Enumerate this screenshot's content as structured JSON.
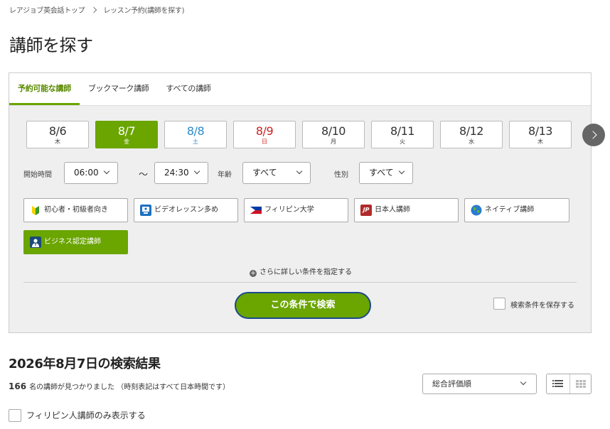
{
  "breadcrumb": {
    "home": "レアジョブ英会話トップ",
    "current": "レッスン予約(講師を探す)"
  },
  "page_title": "講師を探す",
  "tabs": [
    {
      "label": "予約可能な講師",
      "active": true
    },
    {
      "label": "ブックマーク講師",
      "active": false
    },
    {
      "label": "すべての講師",
      "active": false
    }
  ],
  "dates": [
    {
      "date": "8/6",
      "weekday": "木",
      "type": "normal"
    },
    {
      "date": "8/7",
      "weekday": "金",
      "type": "selected"
    },
    {
      "date": "8/8",
      "weekday": "土",
      "type": "sat"
    },
    {
      "date": "8/9",
      "weekday": "日",
      "type": "sun"
    },
    {
      "date": "8/10",
      "weekday": "月",
      "type": "normal"
    },
    {
      "date": "8/11",
      "weekday": "火",
      "type": "normal"
    },
    {
      "date": "8/12",
      "weekday": "水",
      "type": "normal"
    },
    {
      "date": "8/13",
      "weekday": "木",
      "type": "normal"
    }
  ],
  "filters": {
    "start_time_label": "開始時間",
    "start_from": "06:00",
    "tilde": "〜",
    "start_to": "24:30",
    "age_label": "年齢",
    "age_value": "すべて",
    "gender_label": "性別",
    "gender_value": "すべて"
  },
  "tags": [
    {
      "label": "初心者・初級者向き",
      "icon": "beginner-mark-icon",
      "active": false
    },
    {
      "label": "ビデオレッスン多め",
      "icon": "video-lesson-icon",
      "active": false
    },
    {
      "label": "フィリピン大学",
      "icon": "university-icon",
      "active": false
    },
    {
      "label": "日本人講師",
      "icon": "jp-icon",
      "active": false
    },
    {
      "label": "ネイティブ講師",
      "icon": "globe-icon",
      "active": false
    },
    {
      "label": "ビジネス認定講師",
      "icon": "business-person-icon",
      "active": true
    }
  ],
  "jp_icon_text": "JP",
  "more_conditions": "さらに詳しい条件を指定する",
  "plus_symbol": "+",
  "search_button": "この条件で検索",
  "save_conditions": "検索条件を保存する",
  "results": {
    "title": "2026年8月7日の検索結果",
    "count": "166",
    "count_text": "名の講師が見つかりました （時刻表記はすべて日本時間です）",
    "sort_value": "総合評価順",
    "philippine_only": "フィリピン人講師のみ表示する"
  },
  "colors": {
    "accent": "#6aa500",
    "saturday": "#2a8ac8",
    "sunday": "#cc2222"
  }
}
